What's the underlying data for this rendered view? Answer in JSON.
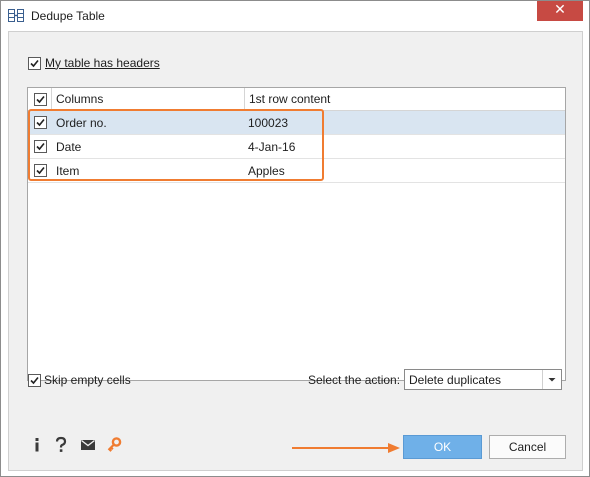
{
  "window": {
    "title": "Dedupe Table",
    "close_glyph": "✕"
  },
  "options": {
    "has_headers_label": "My table has headers",
    "has_headers_checked": true,
    "skip_empty_label": "Skip empty cells",
    "skip_empty_checked": true
  },
  "grid": {
    "header": {
      "columns_label": "Columns",
      "content_label": "1st row content",
      "select_all_checked": true
    },
    "rows": [
      {
        "column": "Order no.",
        "content": "100023",
        "checked": true,
        "selected": true
      },
      {
        "column": "Date",
        "content": "4-Jan-16",
        "checked": true,
        "selected": false
      },
      {
        "column": "Item",
        "content": "Apples",
        "checked": true,
        "selected": false
      }
    ]
  },
  "action": {
    "label": "Select the action:",
    "selected": "Delete duplicates"
  },
  "buttons": {
    "ok": "OK",
    "cancel": "Cancel"
  },
  "footer_icons": [
    "info-icon",
    "help-icon",
    "mail-icon",
    "key-icon"
  ],
  "colors": {
    "accent_orange": "#f07c31",
    "ok_button": "#6fb0e8",
    "selected_row": "#d9e5f1",
    "close_button": "#c74a43"
  }
}
